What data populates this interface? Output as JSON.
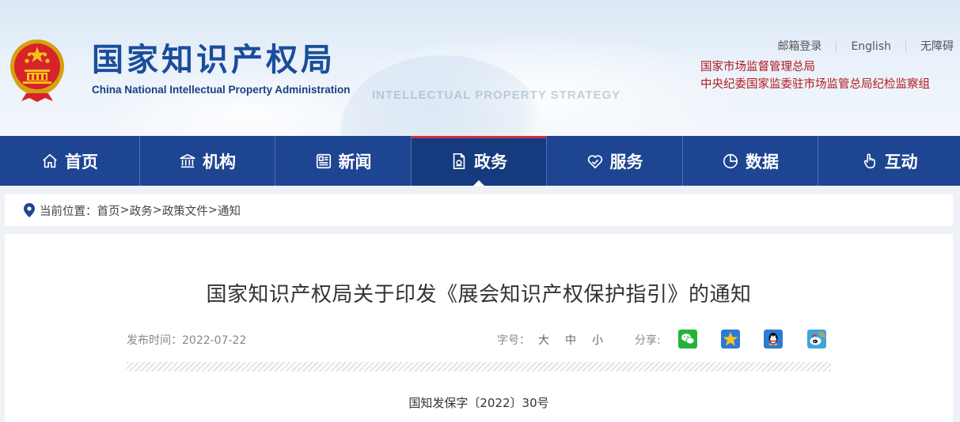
{
  "header": {
    "logo_cn": "国家知识产权局",
    "logo_en": "China National Intellectual Property Administration",
    "watermark": "INTELLECTUAL PROPERTY STRATEGY",
    "top_links": [
      "邮箱登录",
      "English",
      "无障碍"
    ],
    "org_lines": [
      "国家市场监督管理总局",
      "中央纪委国家监委驻市场监管总局纪检监察组"
    ]
  },
  "nav": {
    "items": [
      {
        "label": "首页",
        "icon": "home-icon"
      },
      {
        "label": "机构",
        "icon": "institution-icon"
      },
      {
        "label": "新闻",
        "icon": "news-icon"
      },
      {
        "label": "政务",
        "icon": "government-affairs-icon"
      },
      {
        "label": "服务",
        "icon": "service-icon"
      },
      {
        "label": "数据",
        "icon": "data-icon"
      },
      {
        "label": "互动",
        "icon": "interaction-icon"
      }
    ],
    "active_index": 3
  },
  "breadcrumb": {
    "prefix": "当前位置：",
    "items": [
      "首页",
      "政务",
      "政策文件",
      "通知"
    ],
    "separator": ">"
  },
  "article": {
    "title": "国家知识产权局关于印发《展会知识产权保护指引》的通知",
    "publish_label": "发布时间：2022-07-22",
    "font_size_label": "字号：",
    "font_sizes": [
      "大",
      "中",
      "小"
    ],
    "share_label": "分享:",
    "share_icons": [
      "wechat-icon",
      "qzone-icon",
      "qq-icon",
      "weibo-icon"
    ],
    "doc_number": "国知发保字〔2022〕30号"
  },
  "colors": {
    "nav_bg": "#1d4592",
    "nav_active": "#163a7e",
    "accent_red": "#b3181e",
    "logo_blue": "#1a4d9b"
  }
}
